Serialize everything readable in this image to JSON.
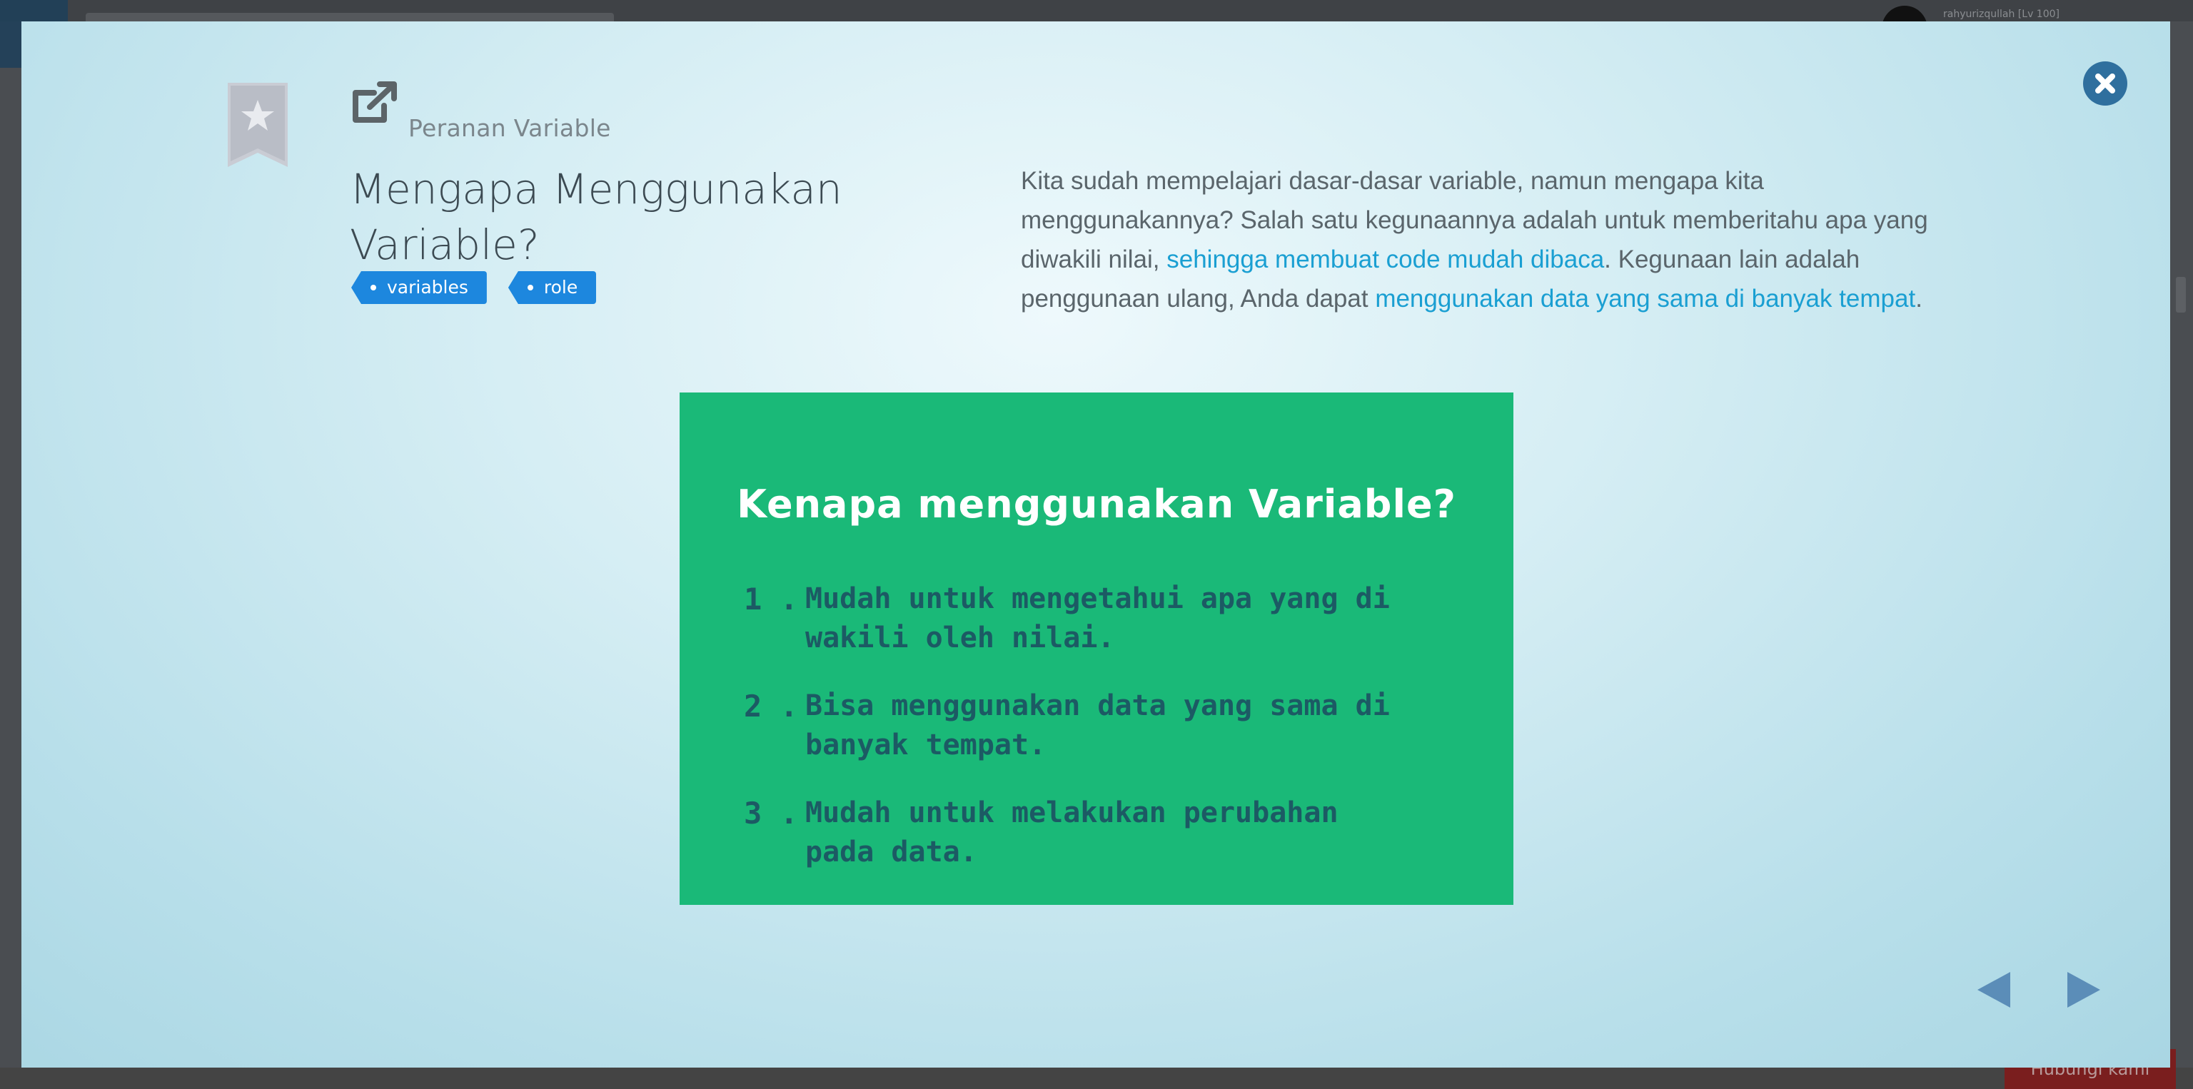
{
  "background": {
    "username": "rahyurizqullah [Lv 100]",
    "bottom_button": "Hubungi kami"
  },
  "lesson": {
    "category": "Peranan Variable",
    "title": "Mengapa Menggunakan Variable?",
    "tags": [
      "variables",
      "role"
    ],
    "description": {
      "p1": "Kita sudah mempelajari dasar-dasar variable, namun mengapa kita menggunakannya? Salah satu kegunaannya adalah untuk memberitahu apa yang diwakili nilai, ",
      "link1": "sehingga membuat code mudah dibaca",
      "p2": ". Kegunaan lain adalah penggunaan ulang, Anda dapat ",
      "link2": "menggunakan data yang sama di banyak tempat",
      "p3": "."
    }
  },
  "slide": {
    "title": "Kenapa menggunakan Variable?",
    "items": [
      {
        "num": "1 .",
        "text": "Mudah untuk mengetahui apa yang di wakili oleh nilai."
      },
      {
        "num": "2 .",
        "text": "Bisa menggunakan data yang sama di banyak tempat."
      },
      {
        "num": "3 .",
        "text": "Mudah untuk melakukan perubahan pada data."
      }
    ]
  },
  "icons": {
    "bookmark": "bookmark-star-icon",
    "external": "external-link-icon",
    "close": "close-icon",
    "prev": "prev-arrow-icon",
    "next": "next-arrow-icon"
  },
  "colors": {
    "tag": "#1d87de",
    "link": "#1a9fd2",
    "slide_bg": "#1ab978",
    "close_bg": "#2f6f9e"
  }
}
